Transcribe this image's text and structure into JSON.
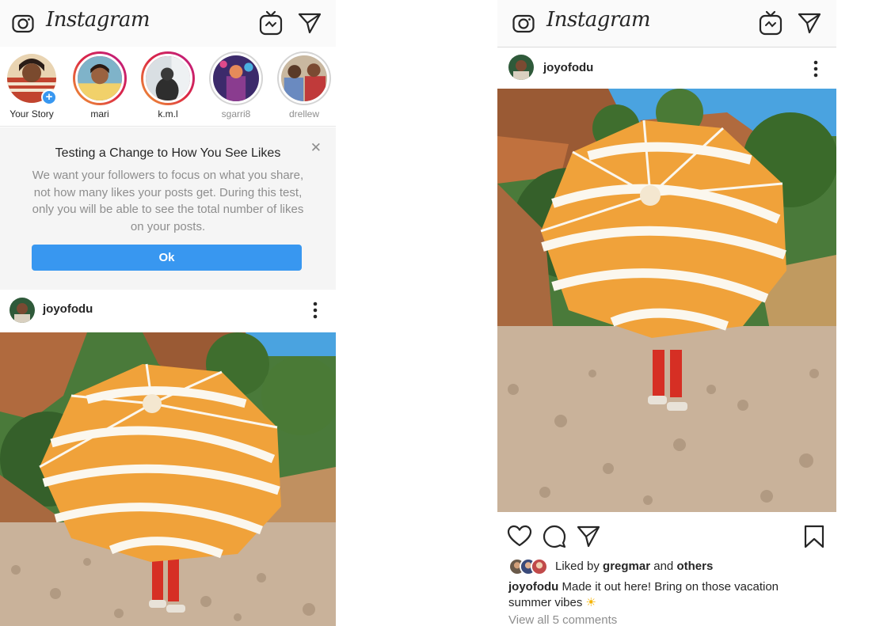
{
  "brand": {
    "wordmark": "Instagram"
  },
  "left_screen": {
    "stories": [
      {
        "name": "Your Story",
        "own": true,
        "avatar_color": "#c1442f"
      },
      {
        "name": "mari",
        "seen": false,
        "avatar_color": "#d9a23e"
      },
      {
        "name": "k.m.l",
        "seen": false,
        "avatar_color": "#b8c4cc"
      },
      {
        "name": "sgarri8",
        "seen": true,
        "avatar_color": "#8a3c8f"
      },
      {
        "name": "drellew",
        "seen": true,
        "avatar_color": "#6a4a3a"
      }
    ],
    "notice": {
      "title": "Testing a Change to How You See Likes",
      "body": "We want your followers to focus on what you share, not how many likes your posts get. During this test, only you will be able to see the total number of likes on your posts.",
      "ok_label": "Ok",
      "close_glyph": "✕"
    },
    "post": {
      "username": "joyofodu"
    }
  },
  "right_screen": {
    "post": {
      "username": "joyofodu",
      "liked_prefix": "Liked by",
      "liked_by_user": "gregmar",
      "liked_and": "and",
      "liked_others": "others",
      "caption_user": "joyofodu",
      "caption_text": "Made it out here! Bring on those vacation summer vibes",
      "caption_emoji": "☀",
      "view_comments": "View all 5 comments"
    }
  },
  "colors": {
    "accent": "#3897f0",
    "text": "#262626",
    "muted": "#8e8e8e",
    "umbrella_orange": "#f0a23a",
    "umbrella_white": "#fbf7ee",
    "sky": "#4aa3e0",
    "rock": "#b06a3e",
    "foliage": "#3f6e2e",
    "pebbles": "#c9b29a",
    "pants": "#d62f24"
  },
  "icons": {
    "camera": "camera-icon",
    "igtv": "igtv-icon",
    "direct": "direct-message-icon",
    "more": "more-options-icon",
    "like": "heart-icon",
    "comment": "comment-icon",
    "share": "share-icon",
    "save": "bookmark-icon",
    "add_story": "plus-icon"
  }
}
